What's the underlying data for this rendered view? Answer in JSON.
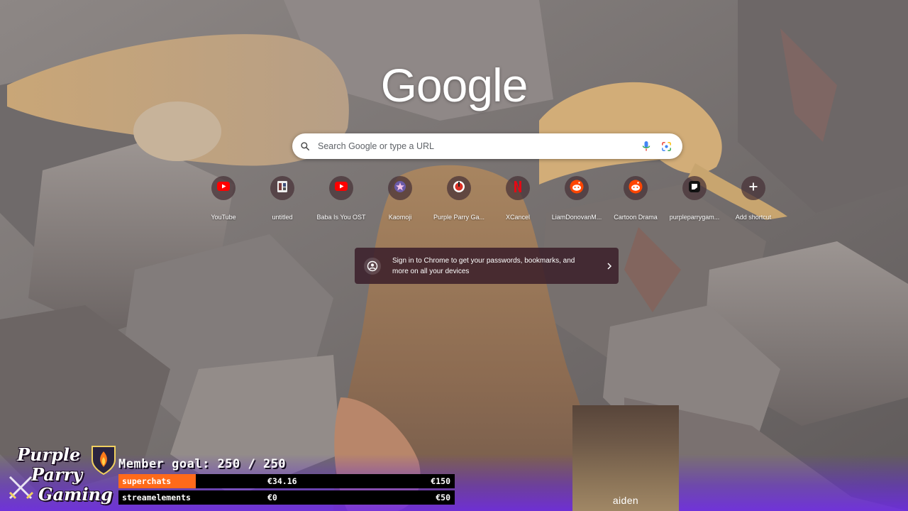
{
  "ntp": {
    "logo_text": "Google",
    "search": {
      "placeholder": "Search Google or type a URL"
    },
    "shortcuts": [
      {
        "title": "YouTube",
        "icon": "youtube-icon"
      },
      {
        "title": "untitled",
        "icon": "page-icon"
      },
      {
        "title": "Baba Is You OST",
        "icon": "youtube-icon"
      },
      {
        "title": "Kaomoji",
        "icon": "star-icon"
      },
      {
        "title": "Purple Parry Ga...",
        "icon": "channel-icon"
      },
      {
        "title": "XCancel",
        "icon": "netflix-icon"
      },
      {
        "title": "LiamDonovanM...",
        "icon": "reddit-icon"
      },
      {
        "title": "Cartoon Drama",
        "icon": "reddit-icon"
      },
      {
        "title": "purpleparrygam...",
        "icon": "app-icon"
      },
      {
        "title": "Add shortcut",
        "icon": "plus-icon"
      }
    ],
    "signin_message": "Sign in to Chrome to get your passwords, bookmarks, and more on all your devices"
  },
  "overlay": {
    "brand": {
      "line1": "Purple",
      "line2": "Parry",
      "line3": "Gaming"
    },
    "goal_title": "Member goal: 250 / 250",
    "goals": [
      {
        "label": "superchats",
        "current": "€34.16",
        "target": "€150",
        "progress": 0.23,
        "color": "#ff6a1a"
      },
      {
        "label": "streamelements",
        "current": "€0",
        "target": "€50",
        "progress": 0.0,
        "color": "#ff6a1a"
      }
    ],
    "webcam_name": "aiden"
  },
  "colors": {
    "youtube": "#ff0000",
    "reddit": "#ff4500",
    "netflix": "#e50914",
    "overlay_purple": "#6e28eb",
    "goal_fill": "#ff6a1a"
  }
}
